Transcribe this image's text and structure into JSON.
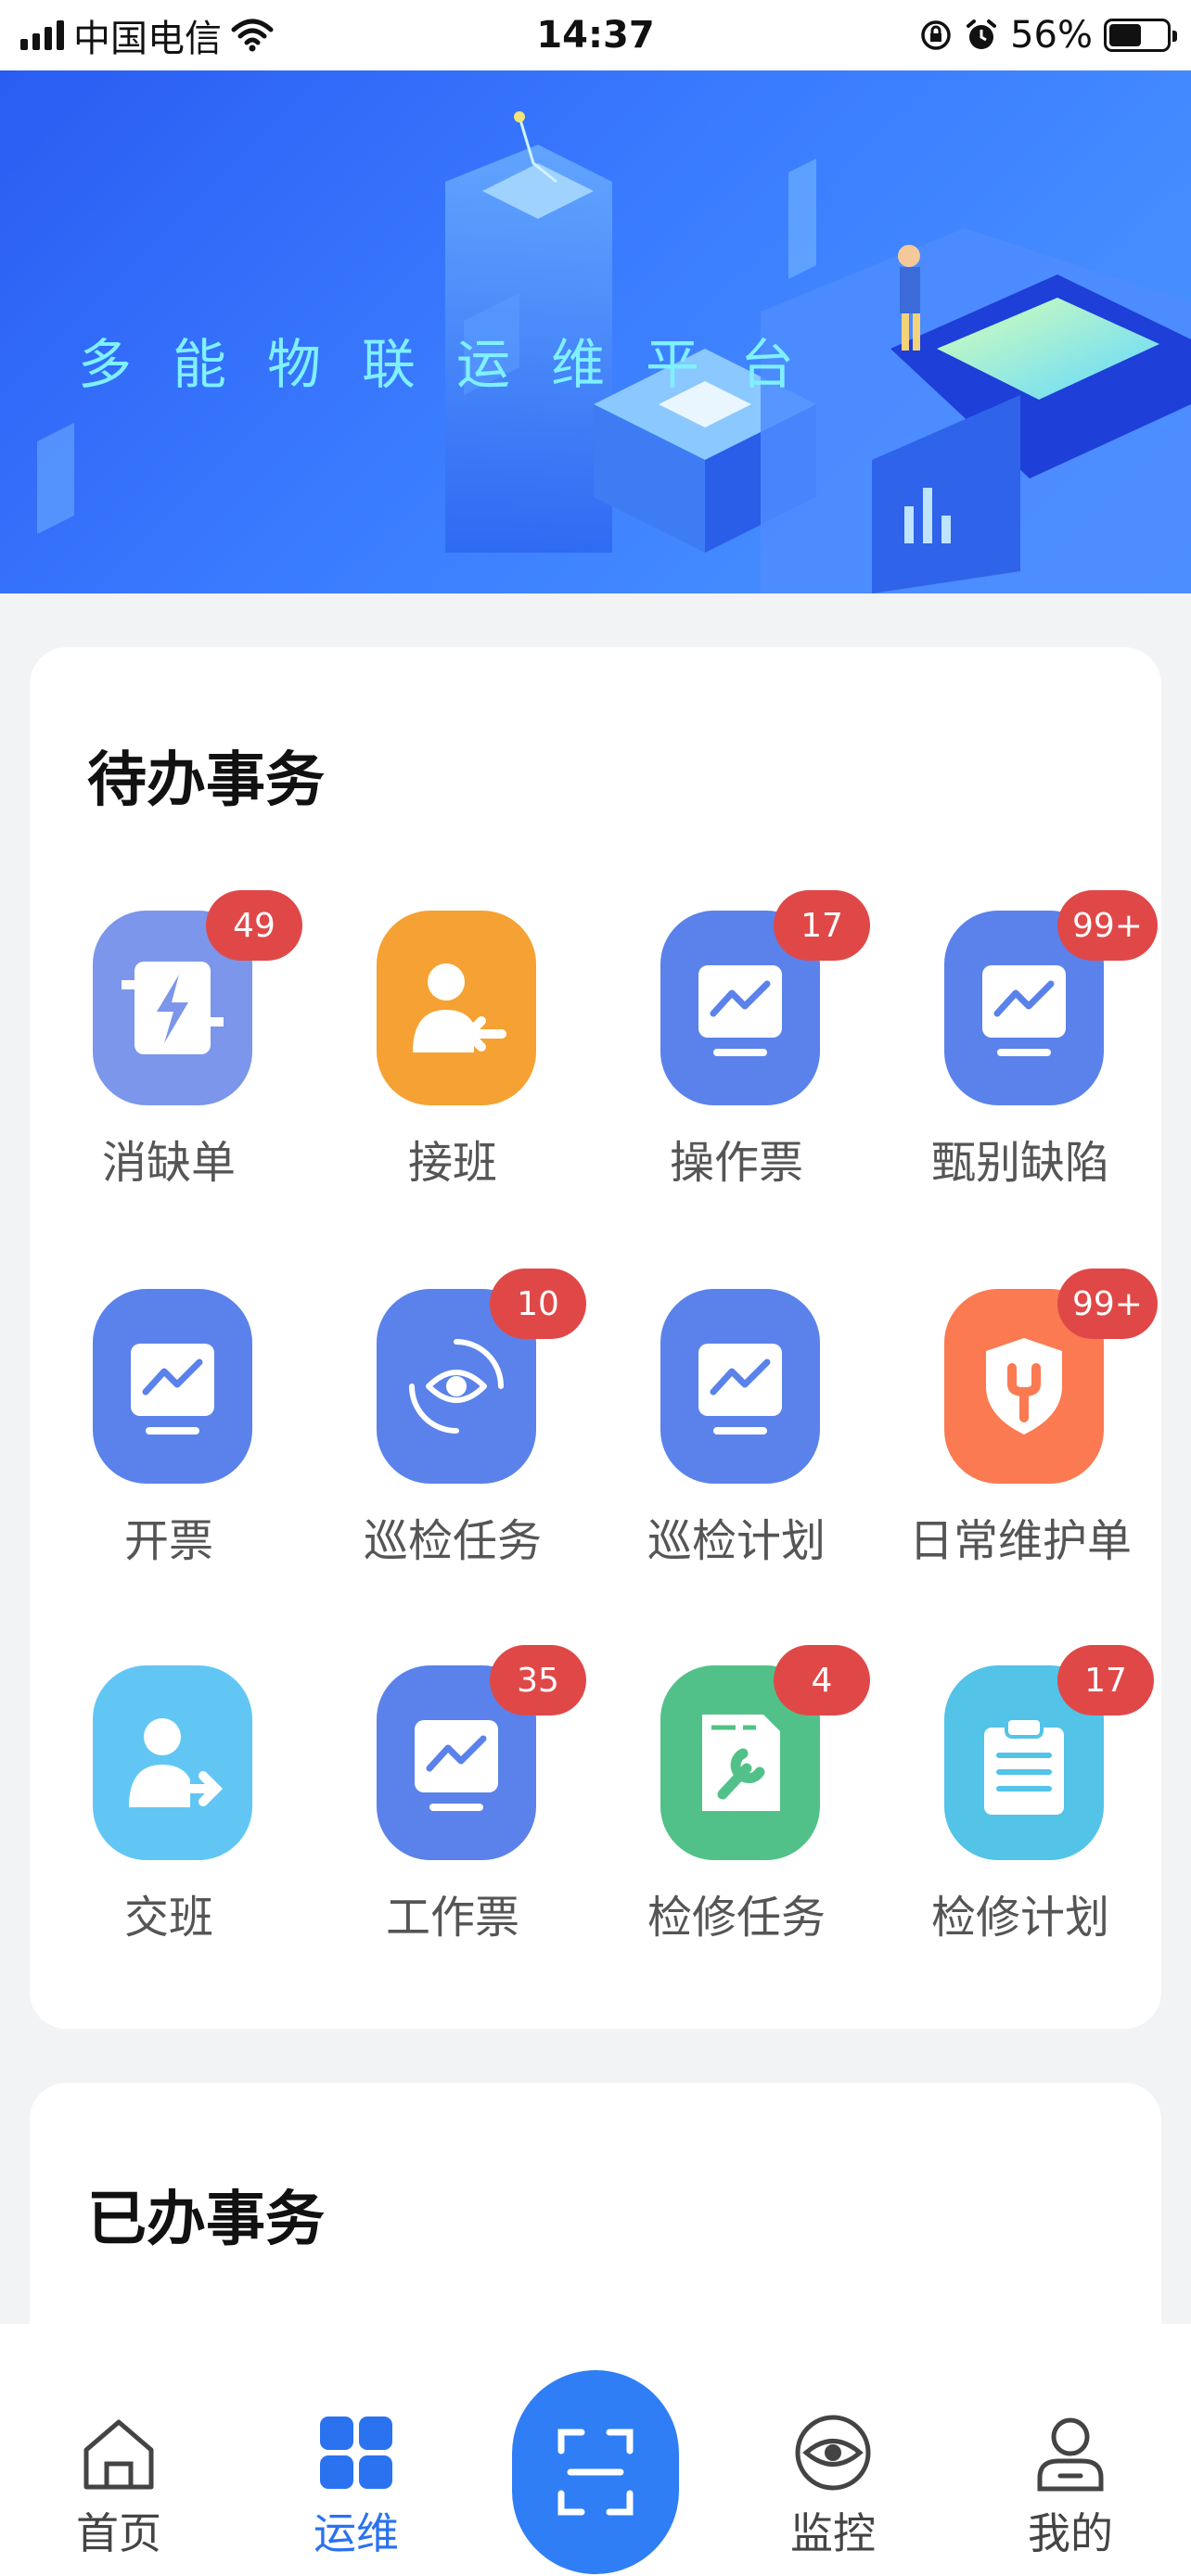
{
  "status_bar": {
    "carrier": "中国电信",
    "time": "14:37",
    "battery": "56%",
    "battery_level": 0.56
  },
  "banner": {
    "title": "多能物联运维平台"
  },
  "todo": {
    "title": "待办事务",
    "items": [
      {
        "label": "消缺单",
        "badge": "49",
        "color": "#7b96ea",
        "icon": "lightning-icon"
      },
      {
        "label": "接班",
        "badge": "",
        "color": "#f6a133",
        "icon": "user-arrow-in-icon"
      },
      {
        "label": "操作票",
        "badge": "17",
        "color": "#5a82ea",
        "icon": "monitor-chart-icon"
      },
      {
        "label": "甄别缺陷",
        "badge": "99+",
        "color": "#5a82ea",
        "icon": "monitor-chart-icon"
      },
      {
        "label": "开票",
        "badge": "",
        "color": "#5a82ea",
        "icon": "monitor-chart-icon"
      },
      {
        "label": "巡检任务",
        "badge": "10",
        "color": "#5a82ea",
        "icon": "eye-scan-icon"
      },
      {
        "label": "巡检计划",
        "badge": "",
        "color": "#5a82ea",
        "icon": "monitor-chart-icon"
      },
      {
        "label": "日常维护单",
        "badge": "99+",
        "color": "#fb7a52",
        "icon": "shield-wrench-icon"
      },
      {
        "label": "交班",
        "badge": "",
        "color": "#62c6f5",
        "icon": "user-arrow-out-icon"
      },
      {
        "label": "工作票",
        "badge": "35",
        "color": "#5a82ea",
        "icon": "monitor-chart-icon"
      },
      {
        "label": "检修任务",
        "badge": "4",
        "color": "#52c189",
        "icon": "wrench-doc-icon"
      },
      {
        "label": "检修计划",
        "badge": "17",
        "color": "#53c3e8",
        "icon": "clipboard-icon"
      }
    ]
  },
  "done": {
    "title": "已办事务",
    "peek_colors": [
      "#5a82ea",
      "#5a82ea",
      "#9b6ae8",
      "#fb7a52"
    ]
  },
  "tab_bar": {
    "tabs": [
      {
        "label": "首页",
        "icon": "home-icon"
      },
      {
        "label": "运维",
        "icon": "grid-icon",
        "active": true
      },
      {
        "label": "",
        "icon": "scan-icon"
      },
      {
        "label": "监控",
        "icon": "eye-icon"
      },
      {
        "label": "我的",
        "icon": "user-icon"
      }
    ],
    "active_color": "#2a72f0"
  }
}
